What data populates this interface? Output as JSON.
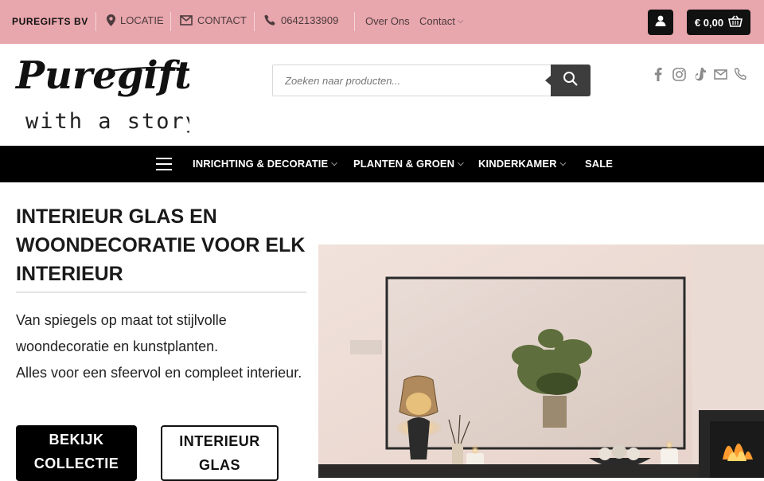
{
  "topbar": {
    "company": "PUREGIFTS BV",
    "location_label": "LOCATIE",
    "contact_label": "CONTACT",
    "phone": "0642133909",
    "links": [
      {
        "label": "Over Ons"
      },
      {
        "label": "Contact"
      }
    ],
    "cart_total": "€ 0,00",
    "icons": [
      "map-pin-icon",
      "envelope-icon",
      "phone-icon",
      "user-icon",
      "shopping-basket-icon",
      "chevron-down-icon"
    ]
  },
  "header": {
    "logo_main": "Puregifts",
    "logo_tagline": "with a story",
    "search_placeholder": "Zoeken naar producten...",
    "social_icons": [
      "facebook-icon",
      "instagram-icon",
      "tiktok-icon",
      "envelope-icon",
      "phone-icon"
    ]
  },
  "nav": {
    "items": [
      {
        "label": "INRICHTING & DECORATIE",
        "dropdown": true
      },
      {
        "label": "PLANTEN & GROEN",
        "dropdown": true
      },
      {
        "label": "KINDERKAMER",
        "dropdown": true
      },
      {
        "label": "SALE",
        "dropdown": false
      }
    ]
  },
  "hero": {
    "title": "INTERIEUR GLAS EN WOONDECORATIE VOOR ELK INTERIEUR",
    "text_line1": "Van spiegels op maat tot stijlvolle woondecoratie en kunstplanten.",
    "text_line2": "Alles voor een sfeervol en compleet interieur.",
    "primary_button": "BEKIJK COLLECTIE",
    "secondary_button": "INTERIEUR GLAS"
  },
  "colors": {
    "topbar": "#e8a6ad",
    "dark": "#000000",
    "search_button": "#3d3d3d"
  }
}
